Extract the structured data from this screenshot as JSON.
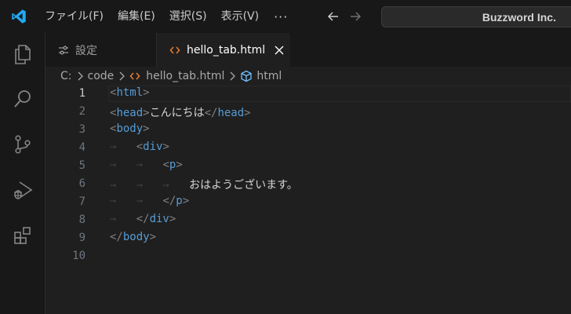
{
  "menu": {
    "items": [
      "ファイル(F)",
      "編集(E)",
      "選択(S)",
      "表示(V)"
    ],
    "more": "···"
  },
  "search": {
    "text": "Buzzword Inc."
  },
  "activity": {
    "icons": [
      "files-icon",
      "search-icon",
      "source-control-icon",
      "run-debug-icon",
      "extensions-icon"
    ]
  },
  "tabs": [
    {
      "label": "設定",
      "active": false,
      "icon": "settings-sliders-icon"
    },
    {
      "label": "hello_tab.html",
      "active": true,
      "icon": "html-code-icon"
    }
  ],
  "breadcrumb": {
    "drive": "C:",
    "folder": "code",
    "file": "hello_tab.html",
    "symbol": "html"
  },
  "editor": {
    "current_line": 1,
    "lines": [
      {
        "n": "1",
        "indent": "",
        "open": "html",
        "text": "",
        "close": ""
      },
      {
        "n": "2",
        "indent": "",
        "open": "head",
        "text": "こんにちは",
        "close": "head"
      },
      {
        "n": "3",
        "indent": "",
        "open": "body",
        "text": "",
        "close": ""
      },
      {
        "n": "4",
        "indent": "→   ",
        "open": "div",
        "text": "",
        "close": ""
      },
      {
        "n": "5",
        "indent": "→   →   ",
        "open": "p",
        "text": "",
        "close": ""
      },
      {
        "n": "6",
        "indent": "→   →   →   ",
        "open": "",
        "text": "おはようございます。",
        "close": ""
      },
      {
        "n": "7",
        "indent": "→   →   ",
        "open": "",
        "text": "",
        "close": "p"
      },
      {
        "n": "8",
        "indent": "→   ",
        "open": "",
        "text": "",
        "close": "div"
      },
      {
        "n": "9",
        "indent": "",
        "open": "",
        "text": "",
        "close": "body"
      },
      {
        "n": "10",
        "indent": "",
        "open": "",
        "text": "",
        "close": ""
      }
    ]
  },
  "colors": {
    "tag": "#569cd6",
    "bracket": "#808080",
    "text": "#d4d4d4",
    "html_icon": "#e37933",
    "symbol_icon": "#75beff",
    "logo": "#23a9f2"
  }
}
